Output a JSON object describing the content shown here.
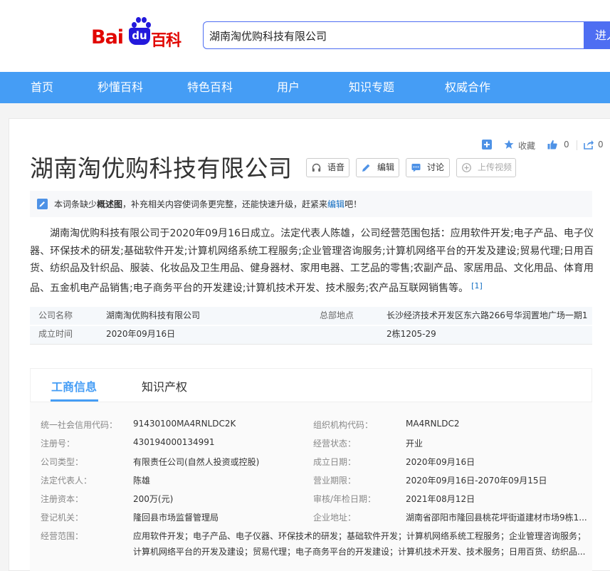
{
  "logo": {
    "part1": "Bai",
    "part2": "du",
    "part3": "百科"
  },
  "search": {
    "value": "湖南淘优购科技有限公司",
    "button": "进入"
  },
  "nav": [
    {
      "label": "首页"
    },
    {
      "label": "秒懂百科"
    },
    {
      "label": "特色百科"
    },
    {
      "label": "用户"
    },
    {
      "label": "知识专题"
    },
    {
      "label": "权威合作"
    }
  ],
  "actions": {
    "collect": "收藏",
    "likes": "0",
    "shares": "0"
  },
  "title": "湖南淘优购科技有限公司",
  "title_buttons": {
    "voice": "语音",
    "edit": "编辑",
    "discuss": "讨论",
    "upload_video": "上传视频"
  },
  "notice": {
    "text1": "本词条缺少",
    "bold": "概述图",
    "text2": "，补充相关内容使词条更完整，还能快速升级，赶紧来",
    "link": "编辑",
    "text3": "吧！"
  },
  "summary": {
    "text": "湖南淘优购科技有限公司于2020年09月16日成立。法定代表人陈雄，公司经营范围包括：应用软件开发;电子产品、电子仪器、环保技术的研发;基础软件开发;计算机网络系统工程服务;企业管理咨询服务;计算机网络平台的开发及建设;贸易代理;日用百货、纺织品及针织品、服装、化妆品及卫生用品、健身器材、家用电器、工艺品的零售;农副产品、家居用品、文化用品、体育用品、五金机电产品销售;电子商务平台的开发建设;计算机技术开发、技术服务;农产品互联网销售等。",
    "ref": "[1]"
  },
  "basic_info": {
    "name_label": "公司名称",
    "name_value": "湖南淘优购科技有限公司",
    "hq_label": "总部地点",
    "hq_value_line1": "长沙经济技术开发区东六路266号华润置地广场一期1",
    "hq_value_line2": "2栋1205-29",
    "founded_label": "成立时间",
    "founded_value": "2020年09月16日"
  },
  "tabs": [
    {
      "label": "工商信息",
      "active": true
    },
    {
      "label": "知识产权",
      "active": false
    }
  ],
  "business": {
    "credit_code_label": "统一社会信用代码：",
    "credit_code": "91430100MA4RNLDC2K",
    "org_code_label": "组织机构代码：",
    "org_code": "MA4RNLDC2",
    "reg_no_label": "注册号：",
    "reg_no": "430194000134991",
    "status_label": "经营状态：",
    "status": "开业",
    "type_label": "公司类型：",
    "type": "有限责任公司(自然人投资或控股)",
    "est_date_label": "成立日期：",
    "est_date": "2020年09月16日",
    "legal_rep_label": "法定代表人：",
    "legal_rep": "陈雄",
    "term_label": "营业期限：",
    "term": "2020年09月16日-2070年09月15日",
    "capital_label": "注册资本：",
    "capital": "200万(元)",
    "audit_date_label": "审核/年检日期：",
    "audit_date": "2021年08月12日",
    "authority_label": "登记机关：",
    "authority": "隆回县市场监督管理局",
    "address_label": "企业地址：",
    "address": "湖南省邵阳市隆回县桃花坪街道建材市场9栋1...",
    "scope_label": "经营范围：",
    "scope": "应用软件开发；电子产品、电子仪器、环保技术的研发；基础软件开发；计算机网络系统工程服务；企业管理咨询服务；计算机网络平台的开发及建设；贸易代理；电子商务平台的开发建设；计算机技术开发、技术服务；日用百货、纺织品..."
  }
}
